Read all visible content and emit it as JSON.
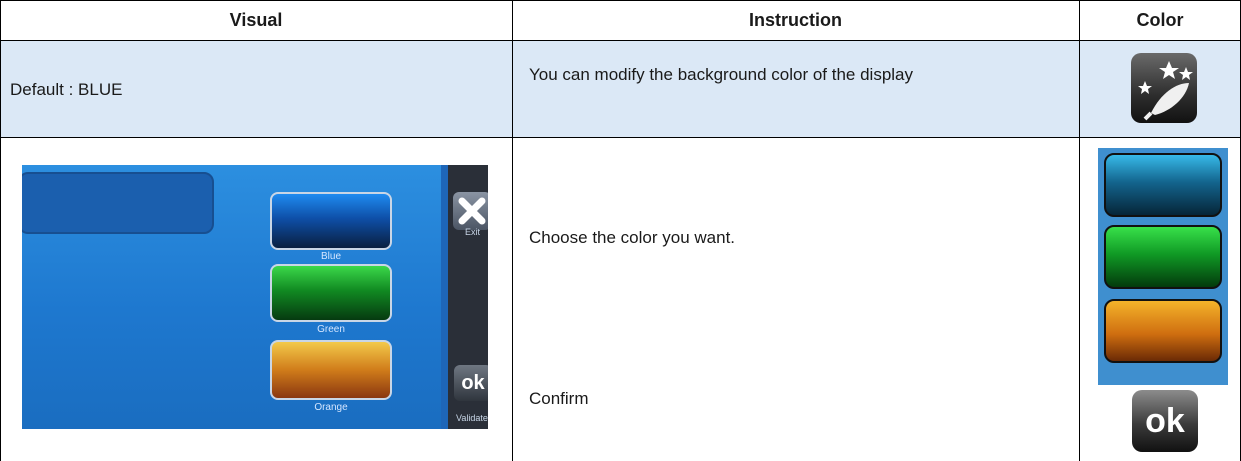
{
  "table": {
    "headers": [
      "Visual",
      "Instruction",
      "Color"
    ],
    "row1": {
      "visual": "Default : BLUE",
      "instruction": "You can modify the background color of the display"
    },
    "row2": {
      "instruction_choose": "Choose the color you want.",
      "instruction_confirm": "Confirm"
    }
  },
  "device_screen": {
    "labels": {
      "blue": "Blue",
      "green": "Green",
      "orange": "Orange",
      "exit": "Exit",
      "validate": "Validate",
      "ok": "ok"
    }
  },
  "color_column": {
    "ok_label": "ok"
  },
  "colors": {
    "header_bg": "#ffffff",
    "row1_bg": "#dbe8f6",
    "screen_bg": "#1e78cf"
  }
}
